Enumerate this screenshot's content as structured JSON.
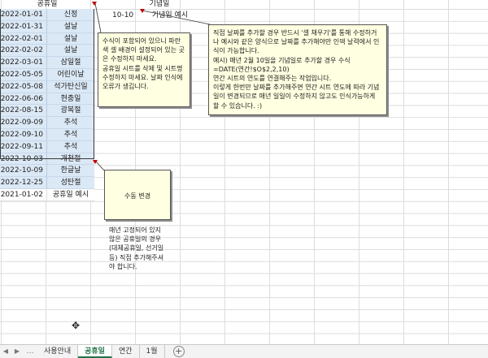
{
  "headers": {
    "holiday_col": "공휴일",
    "memorial_col": "기념일"
  },
  "holidays": [
    {
      "date": "2022-01-01",
      "name": "신정"
    },
    {
      "date": "2022-01-31",
      "name": "설날"
    },
    {
      "date": "2022-02-01",
      "name": "설날"
    },
    {
      "date": "2022-02-02",
      "name": "설날"
    },
    {
      "date": "2022-03-01",
      "name": "삼일절"
    },
    {
      "date": "2022-05-05",
      "name": "어린이날"
    },
    {
      "date": "2022-05-08",
      "name": "석가탄신일"
    },
    {
      "date": "2022-06-06",
      "name": "현충일"
    },
    {
      "date": "2022-08-15",
      "name": "광복절"
    },
    {
      "date": "2022-09-09",
      "name": "추석"
    },
    {
      "date": "2022-09-10",
      "name": "추석"
    },
    {
      "date": "2022-09-11",
      "name": "추석"
    },
    {
      "date": "2022-10-03",
      "name": "개천절"
    },
    {
      "date": "2022-10-09",
      "name": "한글날"
    },
    {
      "date": "2022-12-25",
      "name": "성탄절"
    },
    {
      "date": "2021-01-02",
      "name": "공휴일 예시"
    }
  ],
  "memorial": {
    "date": "10-10",
    "name": "기념일 예시"
  },
  "notes": {
    "left": "수식이 포함되어 있으니 파란색 셀 배경이 설정되어 있는 곳은 수정하지 마세요.\n공휴일 시트를 삭제 및 시트명 수정하지 마세요. 날짜 인식에 오류가 생깁니다.",
    "right": "직접 날짜를 추가할 경우 반드시 '셀 채우기'를 통해 수정하거나 예시와 같은 양식으로 날짜를 추가해야만 인덱 날력에서 인식이 가능합니다.\n예시) 매년 2월 10일을 기념일로 추가할 경우 수식 =DATE(연간!$O$2,2,10)\n연간 시트의 연도를 연결해주는 작업입니다.\n이렇게 한번만 날짜를 추가해주면 연간 시트 연도에 따라 기념일이 변경되므로 매년 일일이 수정하지 않고도 인식가능하게 할 수 있습니다. :)",
    "bottom_title": "수동 변경",
    "bottom_body": "매년 고정되어 있지 않은 공휴일의 경우(대체공휴일, 선거일 등) 직접 추가해주셔야 합니다."
  },
  "tabs": [
    "사용안내",
    "공휴일",
    "연간",
    "1월"
  ],
  "active_tab": "공휴일",
  "icons": {
    "add_sheet": "+",
    "cursor": "✥"
  }
}
